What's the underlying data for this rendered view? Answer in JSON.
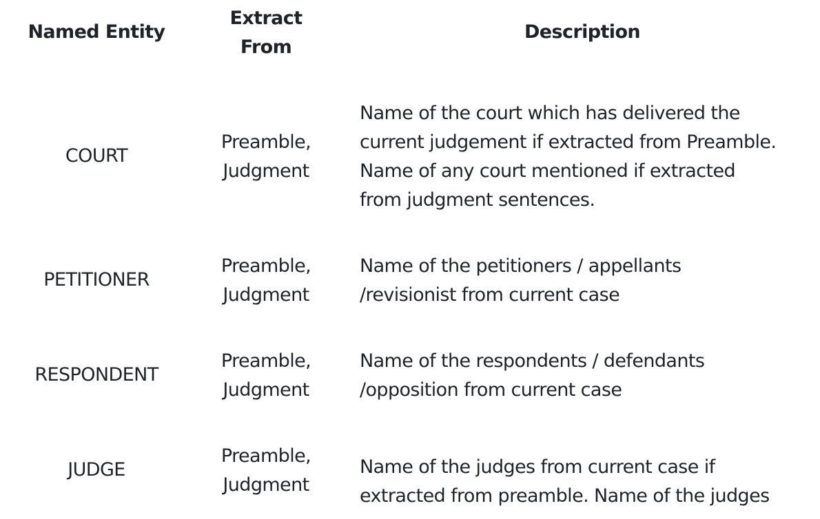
{
  "table": {
    "headers": {
      "entity": "Named Entity",
      "extract_line1": "Extract",
      "extract_line2": "From",
      "description": "Description"
    },
    "rows": [
      {
        "entity": "COURT",
        "extract_line1": "Preamble,",
        "extract_line2": "Judgment",
        "description": "Name of the court which has delivered the\ncurrent judgement if extracted from Preamble.\nName of any court mentioned if extracted\nfrom judgment sentences."
      },
      {
        "entity": "PETITIONER",
        "extract_line1": "Preamble,",
        "extract_line2": "Judgment",
        "description": "Name of the petitioners / appellants\n/revisionist from current case"
      },
      {
        "entity": "RESPONDENT",
        "extract_line1": "Preamble,",
        "extract_line2": "Judgment",
        "description": "Name of the respondents / defendants\n/opposition from current case"
      },
      {
        "entity": "JUDGE",
        "extract_line1": "Preamble,",
        "extract_line2": "Judgment",
        "description": "Name of the judges from current case if\nextracted from preamble. Name of the judges"
      }
    ]
  }
}
